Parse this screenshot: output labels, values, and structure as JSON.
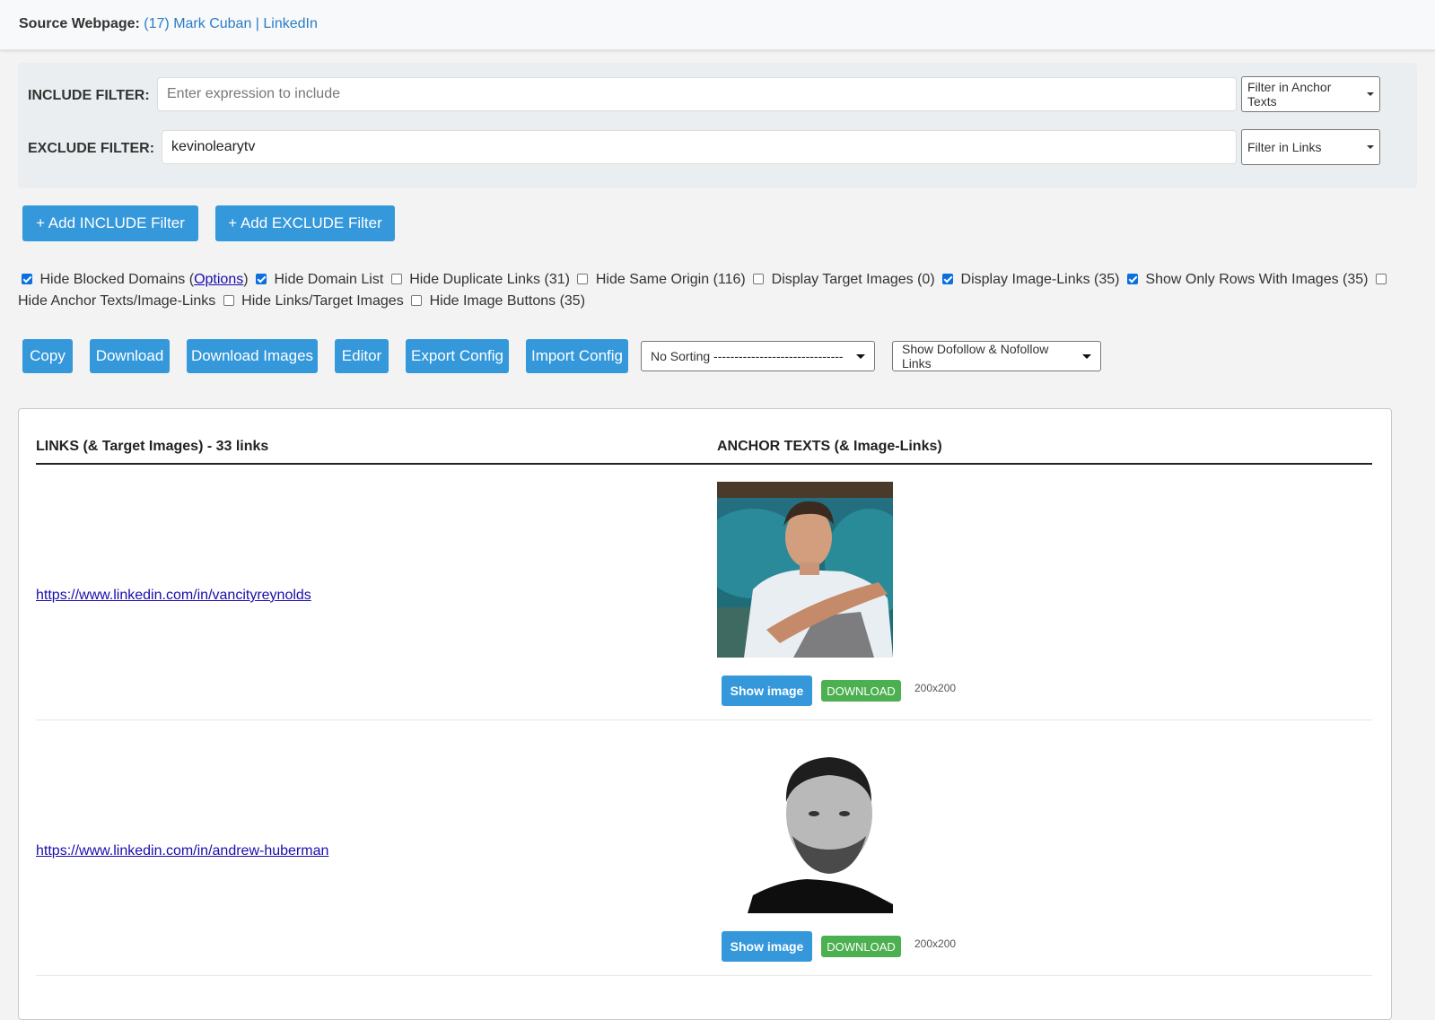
{
  "header": {
    "source_label": "Source Webpage:",
    "source_title": "(17) Mark Cuban | LinkedIn"
  },
  "filters": {
    "include": {
      "label": "INCLUDE FILTER:",
      "value": "",
      "placeholder": "Enter expression to include",
      "scope": "Filter in Anchor Texts"
    },
    "exclude": {
      "label": "EXCLUDE FILTER:",
      "value": "kevinolearytv",
      "placeholder": "",
      "scope": "Filter in Links"
    }
  },
  "filter_buttons": {
    "add_include": "+ Add INCLUDE Filter",
    "add_exclude": "+ Add EXCLUDE Filter"
  },
  "options": [
    {
      "label_pre": "Hide Blocked Domains (",
      "link": "Options",
      "label_post": ")",
      "checked": true
    },
    {
      "label": "Hide Domain List",
      "checked": true
    },
    {
      "label": "Hide Duplicate Links (31)",
      "checked": false
    },
    {
      "label": "Hide Same Origin (116)",
      "checked": false
    },
    {
      "label": "Display Target Images (0)",
      "checked": false
    },
    {
      "label": "Display Image-Links (35)",
      "checked": true
    },
    {
      "label": "Show Only Rows With Images (35)",
      "checked": true
    },
    {
      "label": "Hide Anchor Texts/Image-Links",
      "checked": false
    },
    {
      "label": "Hide Links/Target Images",
      "checked": false
    },
    {
      "label": "Hide Image Buttons (35)",
      "checked": false
    }
  ],
  "toolbar": {
    "copy": "Copy",
    "download": "Download",
    "download_images": "Download Images",
    "editor": "Editor",
    "export_config": "Export Config",
    "import_config": "Import Config",
    "sorting": "No Sorting -------------------------------",
    "follow_filter": "Show Dofollow & Nofollow Links"
  },
  "results": {
    "links_header": "LINKS (& Target Images) - 33 links",
    "anchors_header": "ANCHOR TEXTS (& Image-Links)",
    "rows": [
      {
        "url": "https://www.linkedin.com/in/vancityreynolds",
        "image": "profile-photo-man-white-tshirt-teal-sofa",
        "show_image": "Show image",
        "download": "DOWNLOAD",
        "dimensions": "200x200"
      },
      {
        "url": "https://www.linkedin.com/in/andrew-huberman",
        "image": "profile-photo-man-black-white-beard",
        "show_image": "Show image",
        "download": "DOWNLOAD",
        "dimensions": "200x200"
      }
    ]
  }
}
